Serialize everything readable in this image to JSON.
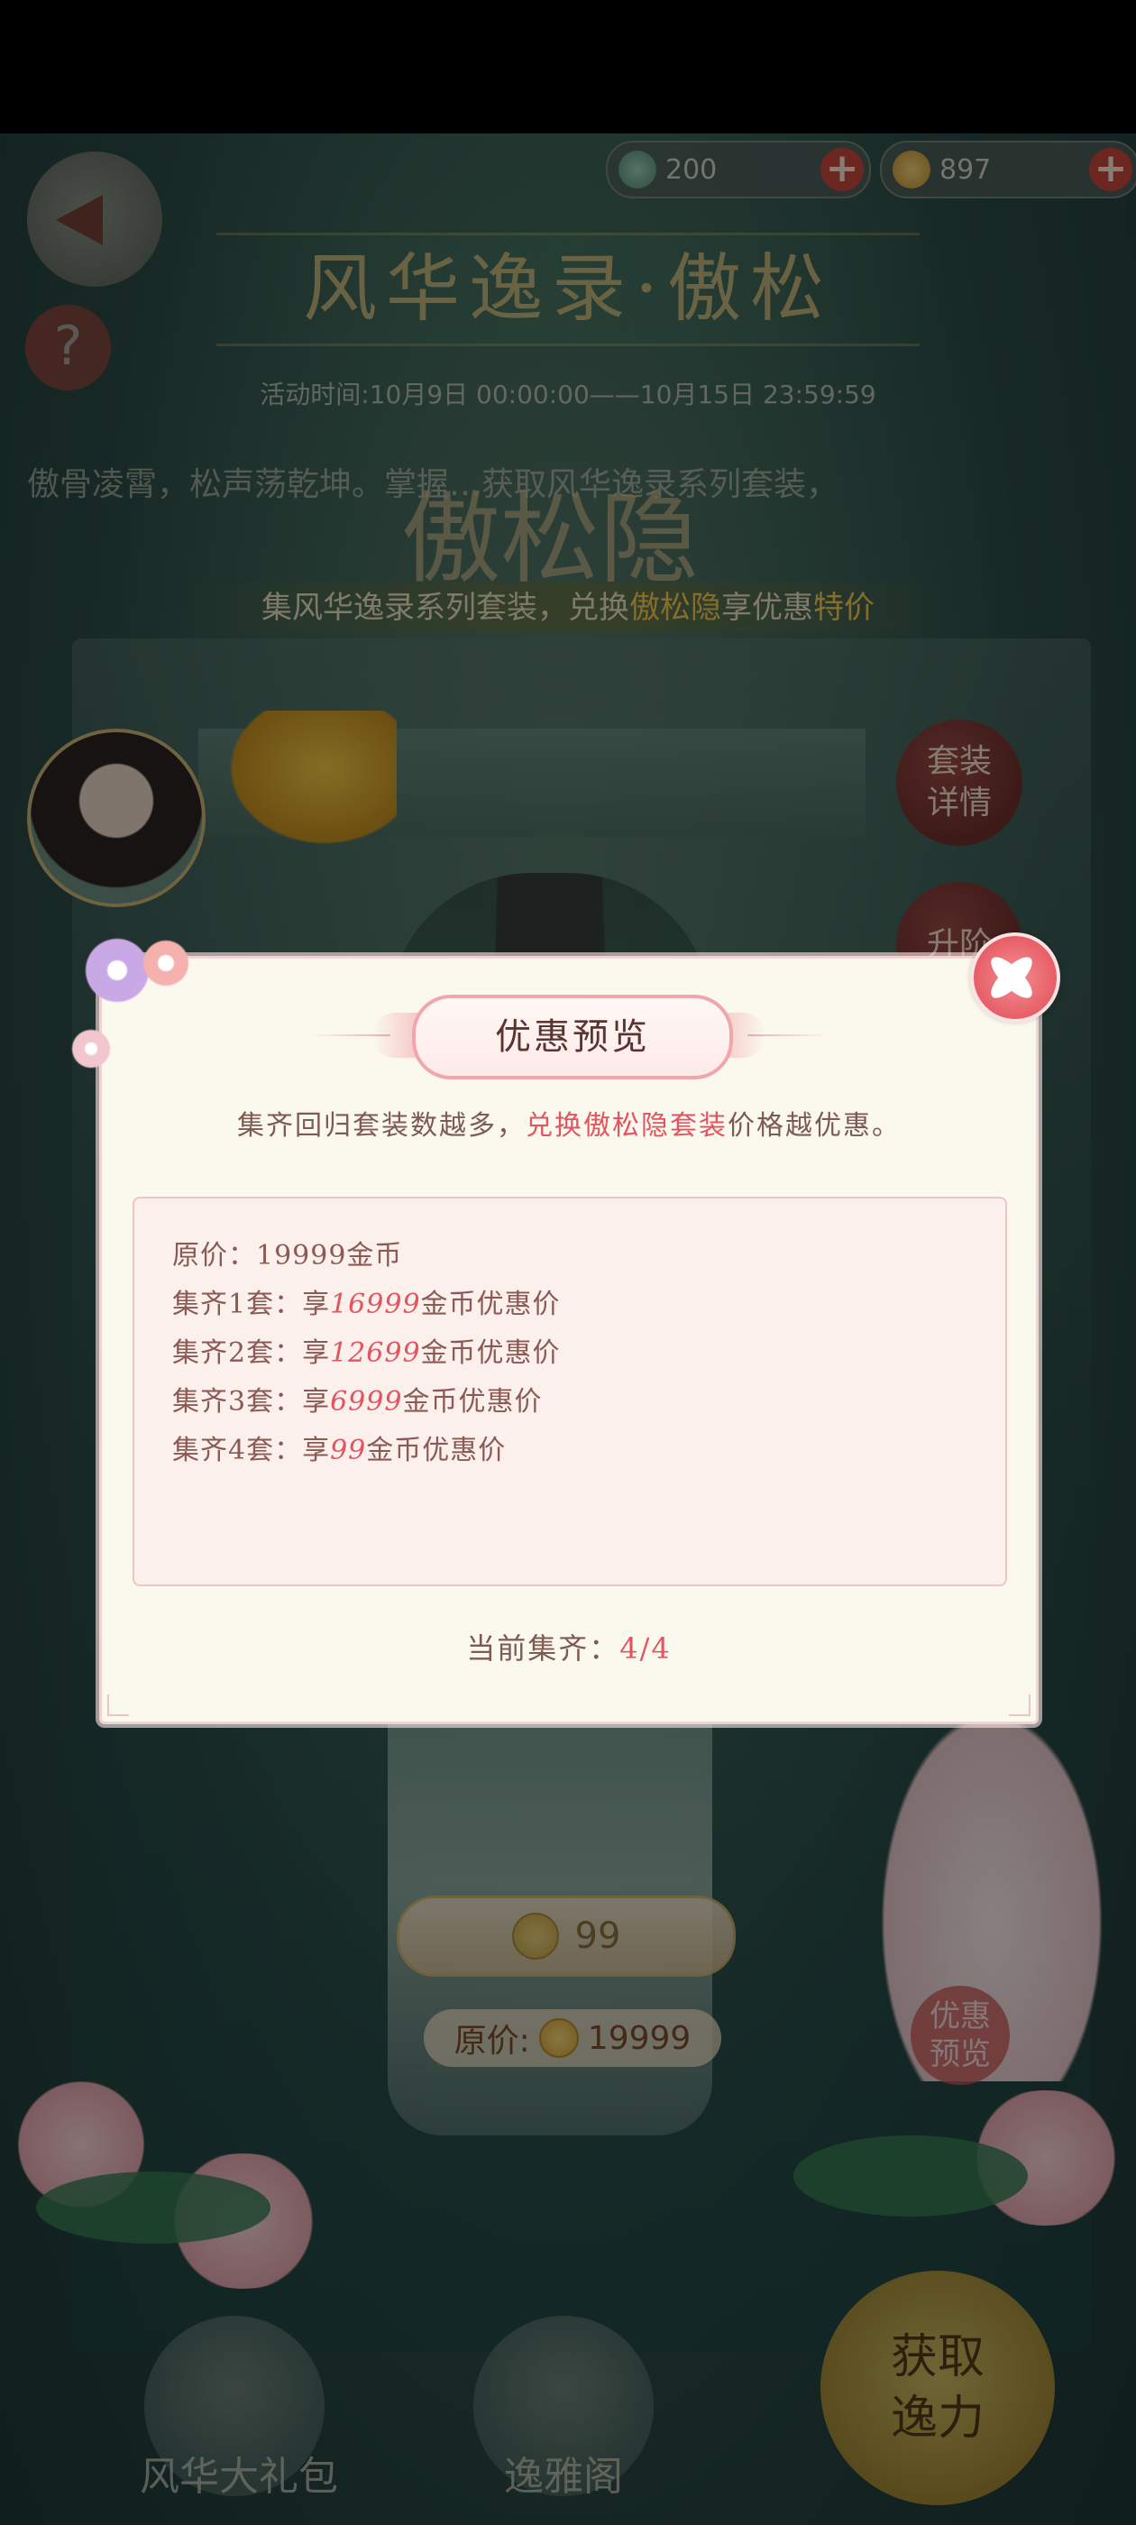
{
  "currency": {
    "gems": "200",
    "coins": "897"
  },
  "header": {
    "title": "风华逸录·傲松",
    "activity_time": "活动时间:10月9日 00:00:00——10月15日 23:59:59",
    "intro": "傲骨凌霄，松声荡乾坤。掌握…获取风华逸录系列套装，",
    "subtitle": "傲松隐",
    "caption_prefix": "集风华逸录系列套装，兑换",
    "caption_highlight1": "傲松隐",
    "caption_mid": "享优惠",
    "caption_highlight2": "特价"
  },
  "side_buttons": {
    "suit_detail": "套装\n详情",
    "upgrade": "升阶"
  },
  "price": {
    "current": "99",
    "original_label": "原价:",
    "original": "19999",
    "promo_preview": "优惠\n预览"
  },
  "bottom_nav": {
    "gift_pack": "风华大礼包",
    "pavilion": "逸雅阁",
    "get_power": "获取\n逸力"
  },
  "modal": {
    "title": "优惠预览",
    "desc_prefix": "集齐回归套装数越多，",
    "desc_highlight": "兑换傲松隐套装",
    "desc_suffix": "价格越优惠。",
    "rows": [
      {
        "prefix": "原价：",
        "value": "19999金币",
        "suffix": ""
      },
      {
        "prefix": "集齐1套：享",
        "value": "16999",
        "suffix": "金币优惠价"
      },
      {
        "prefix": "集齐2套：享",
        "value": "12699",
        "suffix": "金币优惠价"
      },
      {
        "prefix": "集齐3套：享",
        "value": "6999",
        "suffix": "金币优惠价"
      },
      {
        "prefix": "集齐4套：享",
        "value": "99",
        "suffix": "金币优惠价"
      }
    ],
    "status_label": "当前集齐：",
    "status_value": "4/4"
  },
  "colors": {
    "accent": "#e2545f",
    "modal_bg": "#fbf9ee",
    "text_brown": "#8b5a54"
  }
}
